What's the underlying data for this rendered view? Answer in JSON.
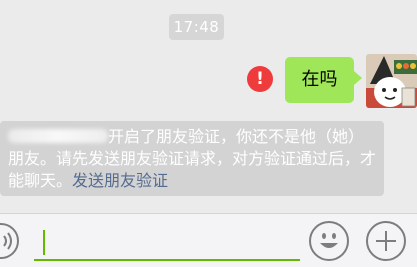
{
  "chat": {
    "timestamp": "17:48",
    "outgoing_message": "在吗",
    "send_status_icon": "error-exclamation-icon",
    "system_notice": {
      "text": "开启了朋友验证，你还不是他（她）朋友。请先发送朋友验证请求，对方验证通过后，才能聊天。",
      "link_text": "发送朋友验证"
    }
  },
  "input_bar": {
    "voice_icon": "voice-icon",
    "emoji_icon": "emoji-icon",
    "plus_icon": "plus-icon"
  },
  "colors": {
    "background": "#ebebeb",
    "bubble_out": "#9fe658",
    "error_red": "#ef3b3b",
    "link": "#556b8f",
    "input_accent": "#62b900"
  }
}
